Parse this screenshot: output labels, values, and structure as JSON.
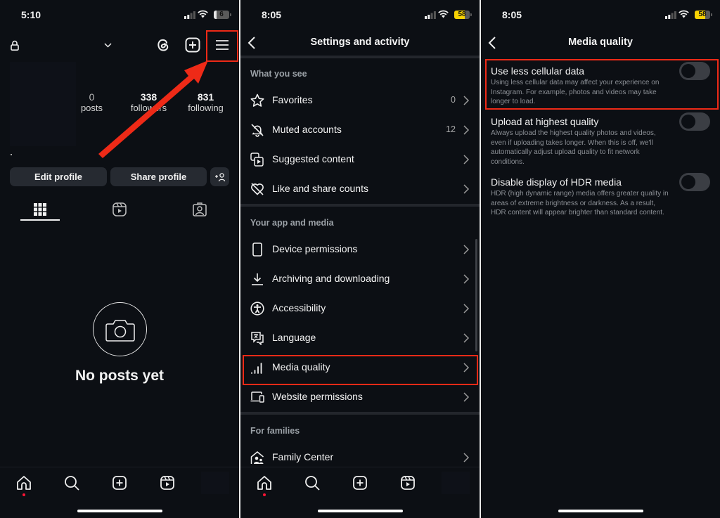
{
  "screens": {
    "profile": {
      "status": {
        "time": "5:10",
        "battery": "6"
      },
      "stats": [
        {
          "value": "0",
          "label": "posts"
        },
        {
          "value": "338",
          "label": "followers"
        },
        {
          "value": "831",
          "label": "following"
        }
      ],
      "buttons": {
        "edit_profile": "Edit profile",
        "share_profile": "Share profile"
      },
      "empty_state": "No posts yet",
      "highlight_color": "#ee2a17"
    },
    "settings": {
      "status": {
        "time": "8:05",
        "battery": "58"
      },
      "title": "Settings and activity",
      "sections": [
        {
          "header": "What you see",
          "items": [
            {
              "label": "Favorites",
              "count": "0",
              "icon": "star-icon"
            },
            {
              "label": "Muted accounts",
              "count": "12",
              "icon": "muted-bell-icon"
            },
            {
              "label": "Suggested content",
              "count": "",
              "icon": "suggested-content-icon"
            },
            {
              "label": "Like and share counts",
              "count": "",
              "icon": "heart-off-icon"
            }
          ]
        },
        {
          "header": "Your app and media",
          "items": [
            {
              "label": "Device permissions",
              "icon": "phone-icon"
            },
            {
              "label": "Archiving and downloading",
              "icon": "download-icon"
            },
            {
              "label": "Accessibility",
              "icon": "accessibility-icon"
            },
            {
              "label": "Language",
              "icon": "language-icon"
            },
            {
              "label": "Media quality",
              "icon": "signal-bars-icon",
              "highlighted": true
            },
            {
              "label": "Website permissions",
              "icon": "devices-icon"
            }
          ]
        },
        {
          "header": "For families",
          "items": [
            {
              "label": "Family Center",
              "icon": "family-home-icon"
            }
          ]
        }
      ]
    },
    "media_quality": {
      "status": {
        "time": "8:05",
        "battery": "58"
      },
      "title": "Media quality",
      "options": [
        {
          "title": "Use less cellular data",
          "description": "Using less cellular data may affect your experience on Instagram. For example, photos and videos may take longer to load.",
          "enabled": false,
          "highlighted": true
        },
        {
          "title": "Upload at highest quality",
          "description": "Always upload the highest quality photos and videos, even if uploading takes longer. When this is off, we'll automatically adjust upload quality to fit network conditions.",
          "enabled": false
        },
        {
          "title": "Disable display of HDR media",
          "description": "HDR (high dynamic range) media offers greater quality in areas of extreme brightness or darkness. As a result, HDR content will appear brighter than standard content.",
          "enabled": false
        }
      ]
    }
  }
}
